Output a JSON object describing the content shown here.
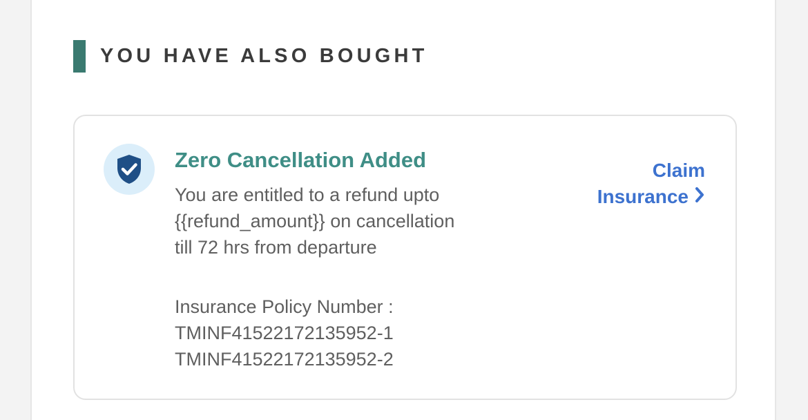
{
  "section": {
    "title": "YOU HAVE ALSO BOUGHT"
  },
  "insurance_card": {
    "icon": "shield-check-icon",
    "title": "Zero Cancellation Added",
    "description": "You are entitled to a refund upto\n{{refund_amount}} on cancellation\ntill 72 hrs from departure",
    "policy_label": "Insurance Policy Number :",
    "policy_numbers": [
      "TMINF41522172135952-1",
      "TMINF41522172135952-2"
    ],
    "claim_line1": "Claim",
    "claim_line2": "Insurance",
    "claim_icon": "chevron-right-icon"
  },
  "colors": {
    "accent": "#3a7a70",
    "title_teal": "#3f8e86",
    "link_blue": "#3d72cf",
    "shield_bg": "#dbeefa",
    "shield_fill": "#1f4f86"
  }
}
